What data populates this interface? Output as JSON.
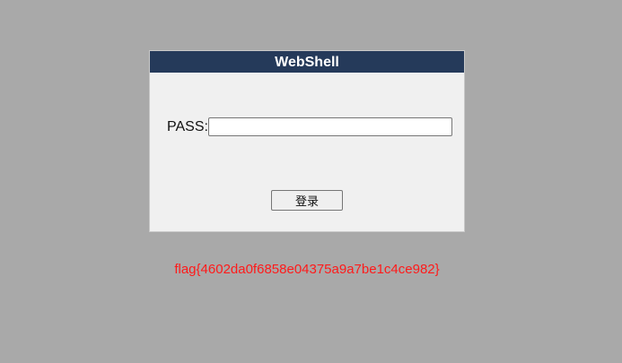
{
  "panel": {
    "title": "WebShell",
    "title_bg": "#253a5a",
    "pass_label": "PASS:",
    "pass_value": "",
    "login_label": "登录"
  },
  "flag": {
    "text": "flag{4602da0f6858e04375a9a7be1c4ce982}",
    "color": "#ff1a1a"
  },
  "page": {
    "background": "#a9a9a9"
  }
}
